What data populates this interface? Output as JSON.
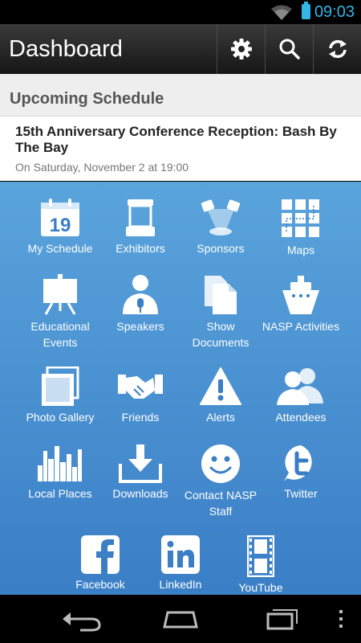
{
  "status_bar": {
    "time": "09:03"
  },
  "action_bar": {
    "title": "Dashboard"
  },
  "schedule": {
    "header": "Upcoming Schedule",
    "event_title": "15th Anniversary Conference Reception: Bash By The Bay",
    "event_date": "On Saturday, November 2 at 19:00"
  },
  "grid": {
    "calendar_day": "19",
    "items": [
      {
        "label": "My Schedule",
        "icon": "calendar-icon"
      },
      {
        "label": "Exhibitors",
        "icon": "booth-icon"
      },
      {
        "label": "Sponsors",
        "icon": "spotlight-icon"
      },
      {
        "label": "Maps",
        "icon": "map-grid-icon"
      },
      {
        "label": "Educational Events",
        "icon": "easel-icon"
      },
      {
        "label": "Speakers",
        "icon": "speaker-icon"
      },
      {
        "label": "Show Documents",
        "icon": "documents-icon"
      },
      {
        "label": "NASP Activities",
        "icon": "ship-icon"
      },
      {
        "label": "Photo Gallery",
        "icon": "photo-icon"
      },
      {
        "label": "Friends",
        "icon": "handshake-icon"
      },
      {
        "label": "Alerts",
        "icon": "alert-icon"
      },
      {
        "label": "Attendees",
        "icon": "people-icon"
      },
      {
        "label": "Local Places",
        "icon": "skyline-icon"
      },
      {
        "label": "Downloads",
        "icon": "download-icon"
      },
      {
        "label": "Contact NASP Staff",
        "icon": "smiley-icon"
      },
      {
        "label": "Twitter",
        "icon": "twitter-icon"
      },
      {
        "label": "Facebook",
        "icon": "facebook-icon"
      },
      {
        "label": "LinkedIn",
        "icon": "linkedin-icon"
      },
      {
        "label": "YouTube",
        "icon": "film-icon"
      }
    ]
  },
  "colors": {
    "grid_top": "#5aa4dc",
    "grid_bottom": "#3a7ec6",
    "status_accent": "#33b5e5"
  }
}
